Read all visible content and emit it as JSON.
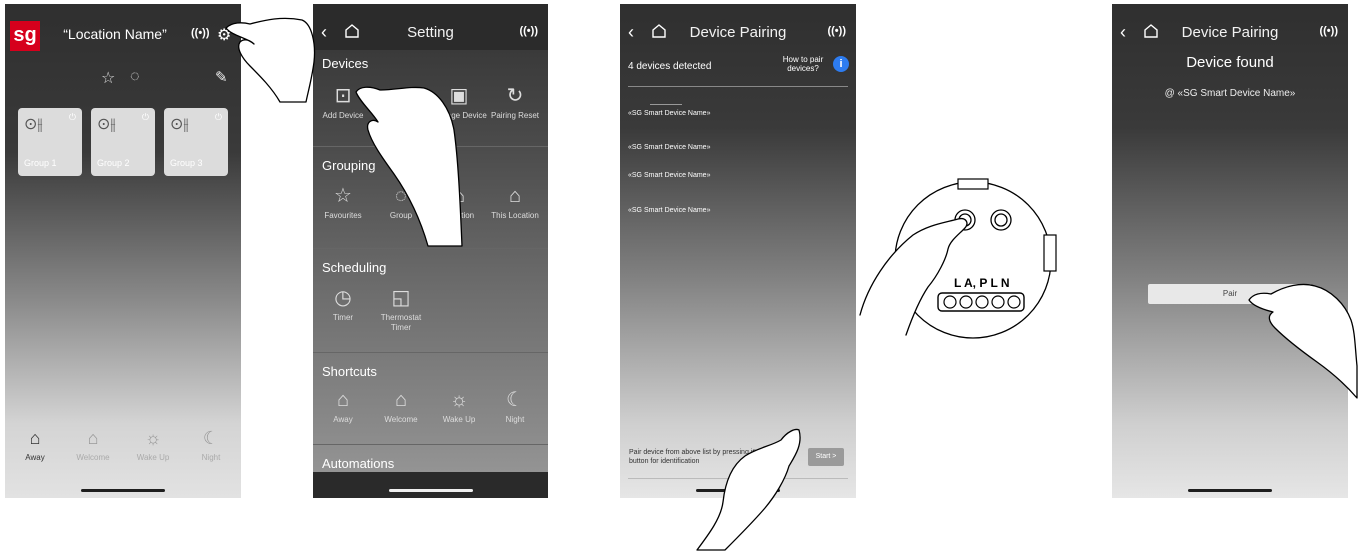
{
  "screen1": {
    "logo": "sg",
    "title": "“Location Name”",
    "signal_icon": "((•))",
    "groups": [
      {
        "label": "Group 1"
      },
      {
        "label": "Group 2"
      },
      {
        "label": "Group 3"
      }
    ],
    "shortcuts": [
      {
        "label": "Away",
        "active": true
      },
      {
        "label": "Welcome",
        "active": false
      },
      {
        "label": "Wake Up",
        "active": false
      },
      {
        "label": "Night",
        "active": false
      }
    ]
  },
  "screen2": {
    "title": "Setting",
    "sections": {
      "devices": {
        "title": "Devices",
        "items": [
          {
            "label": "Add Device"
          },
          {
            "label": ""
          },
          {
            "label": "Manage Device"
          },
          {
            "label": "Pairing Reset"
          }
        ]
      },
      "grouping": {
        "title": "Grouping",
        "items": [
          {
            "label": "Favourites"
          },
          {
            "label": "Group"
          },
          {
            "label": "Location"
          },
          {
            "label": "This Location"
          }
        ]
      },
      "scheduling": {
        "title": "Scheduling",
        "items": [
          {
            "label": "Timer"
          },
          {
            "label": "Thermostat Timer"
          }
        ]
      },
      "shortcuts": {
        "title": "Shortcuts",
        "items": [
          {
            "label": "Away"
          },
          {
            "label": "Welcome"
          },
          {
            "label": "Wake Up"
          },
          {
            "label": "Night"
          }
        ]
      },
      "automations": {
        "title": "Automations"
      }
    }
  },
  "screen3": {
    "title": "Device Pairing",
    "detected": "4 devices detected",
    "how_to": "How to pair devices?",
    "info_icon": "i",
    "devices": [
      "«SG Smart Device Name»",
      "«SG Smart Device Name»",
      "«SG Smart Device Name»",
      "«SG Smart Device Name»"
    ],
    "instruction": "Pair device from above list by pressing it's physical \"R\" button for identification",
    "start_label": "Start >"
  },
  "device_illustration": {
    "terminal_labels": "L A, P L N"
  },
  "screen4": {
    "title": "Device Pairing",
    "found": "Device found",
    "device_name": "@ «SG Smart Device Name»",
    "pair_label": "Pair"
  }
}
